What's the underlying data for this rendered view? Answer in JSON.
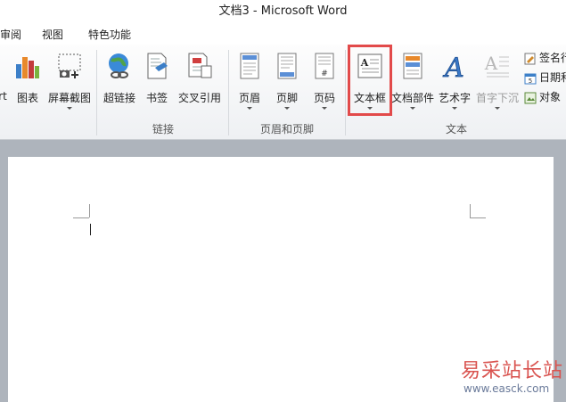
{
  "window": {
    "title": "文档3  -  Microsoft Word"
  },
  "tabs": [
    "审阅",
    "视图",
    "特色功能"
  ],
  "ribbon": {
    "partial_left_label": "rt",
    "buttons": {
      "chart": "图表",
      "screenshot": "屏幕截图",
      "hyperlink": "超链接",
      "bookmark": "书签",
      "crossref": "交叉引用",
      "header": "页眉",
      "footer": "页脚",
      "pagenum": "页码",
      "textbox": "文本框",
      "quickparts": "文档部件",
      "wordart": "艺术字",
      "dropcap": "首字下沉"
    },
    "groups": {
      "links": "链接",
      "headerfooter": "页眉和页脚",
      "text": "文本"
    },
    "small_items": [
      "签名行",
      "日期和",
      "对象"
    ]
  },
  "watermark": {
    "text": "易采站长站",
    "url": "www.easck.com"
  },
  "colors": {
    "highlight": "#e24a4a",
    "workspace": "#aeb4bc"
  }
}
